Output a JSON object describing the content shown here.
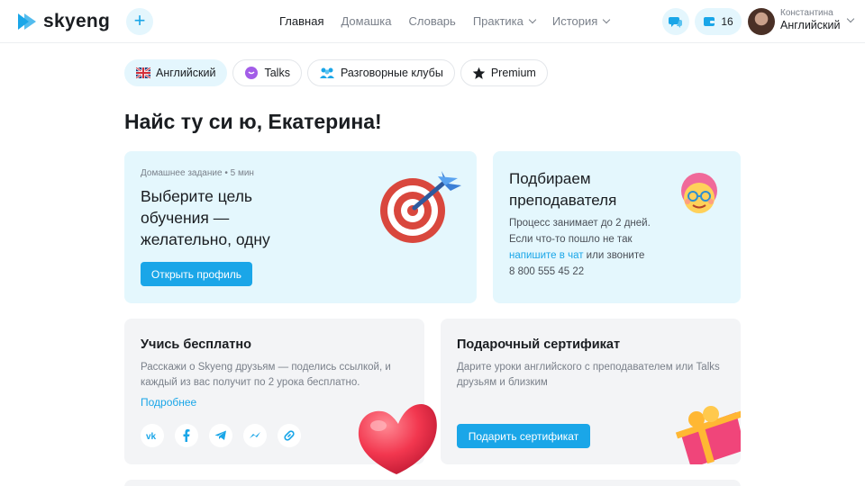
{
  "brand": {
    "name": "skyeng",
    "accent": "#1aa6e8",
    "light_bg": "#e4f7fd"
  },
  "nav": [
    {
      "label": "Главная",
      "active": true,
      "dropdown": false
    },
    {
      "label": "Домашка",
      "active": false,
      "dropdown": false
    },
    {
      "label": "Словарь",
      "active": false,
      "dropdown": false
    },
    {
      "label": "Практика",
      "active": false,
      "dropdown": true
    },
    {
      "label": "История",
      "active": false,
      "dropdown": true
    }
  ],
  "header": {
    "balance": "16",
    "user_name": "Константина",
    "user_language": "Английский"
  },
  "pills": [
    {
      "label": "Английский",
      "icon": "uk-flag-icon",
      "active": true
    },
    {
      "label": "Talks",
      "icon": "talks-bubble-icon",
      "active": false
    },
    {
      "label": "Разговорные клубы",
      "icon": "people-icon",
      "active": false
    },
    {
      "label": "Premium",
      "icon": "star-icon",
      "active": false
    }
  ],
  "greeting": "Найс ту си ю, Екатерина!",
  "homework": {
    "meta": "Домашнее задание • 5 мин",
    "title": "Выберите цель обучения — желательно, одну",
    "button": "Открыть профиль"
  },
  "teacher": {
    "title": "Подбираем преподавателя",
    "line1": "Процесс занимает до 2 дней.",
    "line2": "Если что-то пошло не так",
    "link": "напишите в чат",
    "line3": " или звоните",
    "phone": "8 800 555 45 22"
  },
  "free": {
    "title": "Учись бесплатно",
    "desc": "Расскажи о Skyeng друзьям — поделись ссылкой, и каждый из вас получит по 2 урока бесплатно.",
    "link": "Подробнее",
    "socials": [
      "vk-icon",
      "facebook-icon",
      "telegram-icon",
      "messenger-icon",
      "link-icon"
    ]
  },
  "gift": {
    "title": "Подарочный сертификат",
    "desc": "Дарите уроки английского с преподавателем или Talks друзьям и близким",
    "button": "Подарить сертификат"
  }
}
